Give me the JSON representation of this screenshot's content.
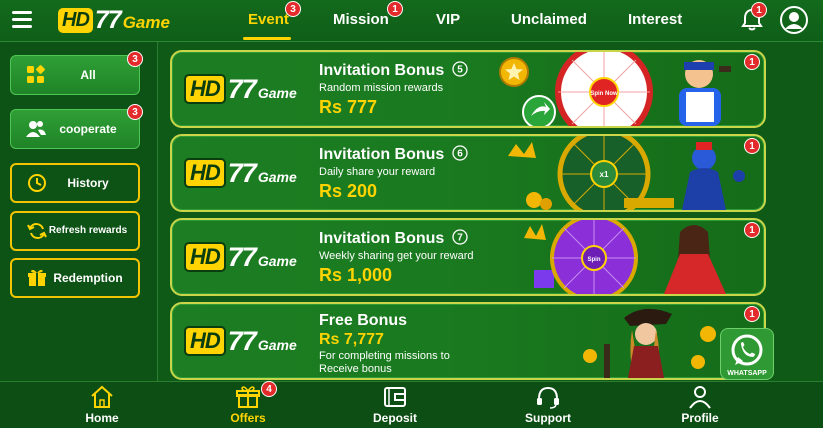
{
  "header": {
    "logo": {
      "hd": "HD",
      "num": "77",
      "game": "Game"
    },
    "tabs": [
      {
        "label": "Event",
        "badge": "3",
        "active": true
      },
      {
        "label": "Mission",
        "badge": "1"
      },
      {
        "label": "VIP"
      },
      {
        "label": "Unclaimed"
      },
      {
        "label": "Interest"
      }
    ],
    "bell_badge": "1",
    "icons": {
      "menu": "hamburger-icon",
      "bell": "bell-icon",
      "profile": "user-circle-icon"
    }
  },
  "sidebar": {
    "items": [
      {
        "label": "All",
        "badge": "3",
        "icon": "grid-icon",
        "style": "filled"
      },
      {
        "label": "cooperate",
        "badge": "3",
        "icon": "users-icon",
        "style": "filled"
      },
      {
        "label": "History",
        "icon": "clock-icon",
        "style": "outline"
      },
      {
        "label": "Refresh rewards",
        "icon": "refresh-icon",
        "style": "outline"
      },
      {
        "label": "Redemption",
        "icon": "gift-icon",
        "style": "outline"
      }
    ]
  },
  "cards": [
    {
      "logo": {
        "hd": "HD",
        "num": "77",
        "game": "Game"
      },
      "title": "Invitation Bonus",
      "step": "5",
      "subtitle": "Random mission rewards",
      "amount": "Rs 777",
      "badge": "1",
      "art_text": "Spin Now"
    },
    {
      "logo": {
        "hd": "HD",
        "num": "77",
        "game": "Game"
      },
      "title": "Invitation Bonus",
      "step": "6",
      "subtitle": "Daily share your reward",
      "amount": "Rs 200",
      "badge": "1",
      "art_text": "x1"
    },
    {
      "logo": {
        "hd": "HD",
        "num": "77",
        "game": "Game"
      },
      "title": "Invitation Bonus",
      "step": "7",
      "subtitle": "Weekly sharing get your reward",
      "amount": "Rs 1,000",
      "badge": "1",
      "art_text": "Spin"
    },
    {
      "logo": {
        "hd": "HD",
        "num": "77",
        "game": "Game"
      },
      "title": "Free Bonus",
      "amount": "Rs 7,777",
      "description": "For completing missions to Receive bonus",
      "badge": "1"
    }
  ],
  "whatsapp": {
    "label": "WHATSAPP"
  },
  "bottom_nav": [
    {
      "label": "Home",
      "icon": "home-icon"
    },
    {
      "label": "Offers",
      "icon": "gift-icon",
      "badge": "4",
      "active": true
    },
    {
      "label": "Deposit",
      "icon": "wallet-icon"
    },
    {
      "label": "Support",
      "icon": "headset-icon"
    },
    {
      "label": "Profile",
      "icon": "person-icon"
    }
  ],
  "colors": {
    "accent": "#ffd400",
    "background": "#0f5a17",
    "badge": "#e32b2b",
    "card_border": "#c9d64a"
  }
}
